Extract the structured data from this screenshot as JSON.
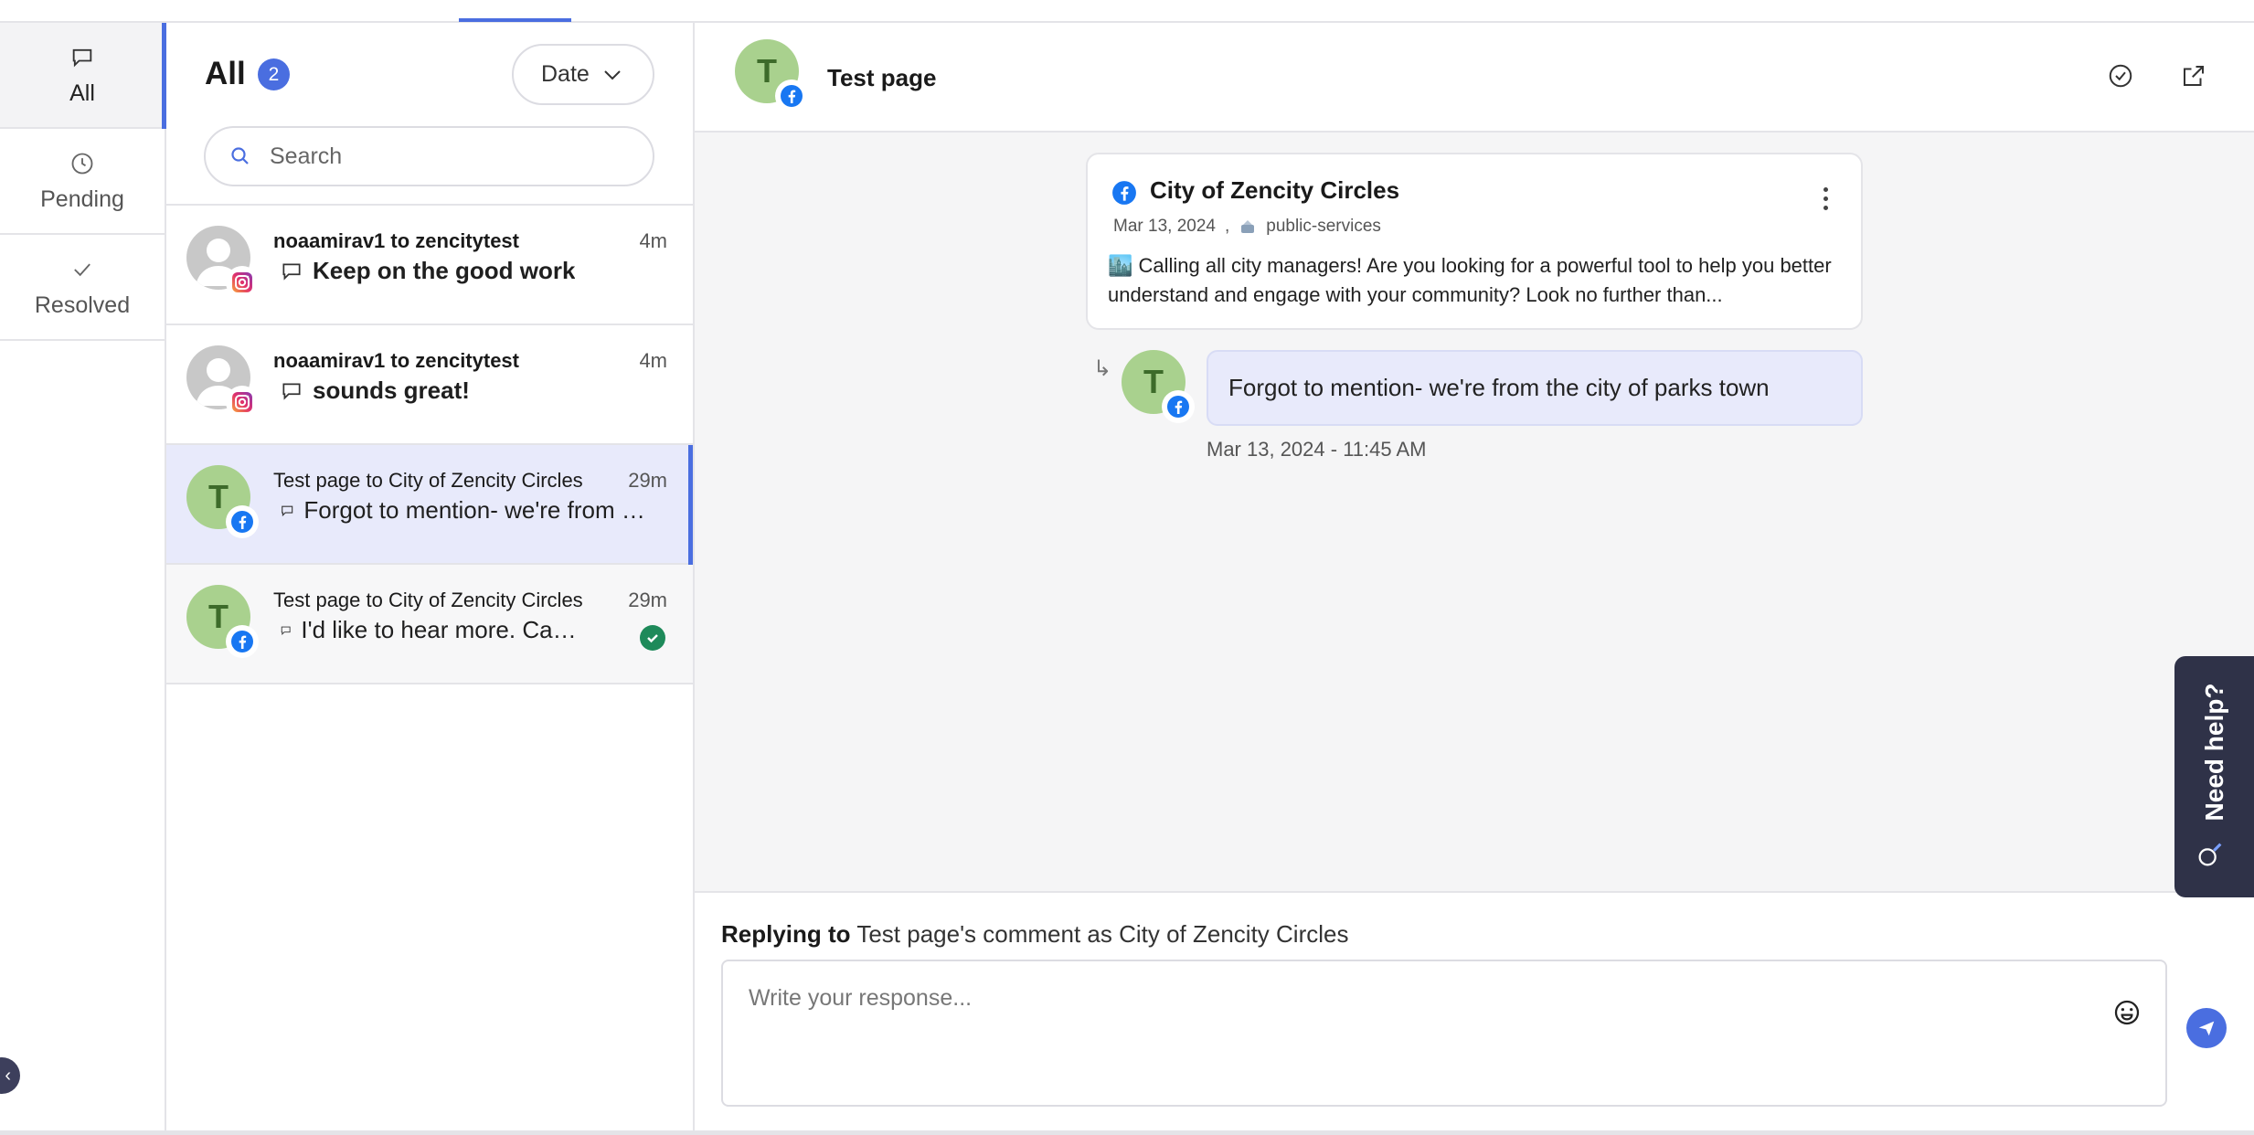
{
  "nav": {
    "items": [
      {
        "label": "All",
        "icon": "chat-bubble-icon",
        "active": true
      },
      {
        "label": "Pending",
        "icon": "clock-icon",
        "active": false
      },
      {
        "label": "Resolved",
        "icon": "checkmark-icon",
        "active": false
      }
    ]
  },
  "list": {
    "title": "All",
    "count": "2",
    "sort_label": "Date",
    "search_placeholder": "Search",
    "conversations": [
      {
        "from": "noaamirav1 to zencitytest",
        "time": "4m",
        "message": "Keep on the good work",
        "network": "instagram",
        "avatar": "user"
      },
      {
        "from": "noaamirav1 to zencitytest",
        "time": "4m",
        "message": "sounds great!",
        "network": "instagram",
        "avatar": "user"
      },
      {
        "from": "Test page to City of Zencity Circles",
        "time": "29m",
        "message": "Forgot to mention- we're from the city of parks town",
        "network": "facebook",
        "avatar": "T",
        "selected": true
      },
      {
        "from": "Test page to City of Zencity Circles",
        "time": "29m",
        "message": "I'd like to hear more. Can you tell me more about it?",
        "network": "facebook",
        "avatar": "T",
        "resolved": true
      }
    ]
  },
  "detail": {
    "title": "Test page",
    "avatar_letter": "T",
    "post": {
      "page_name": "City of Zencity Circles",
      "date": "Mar 13, 2024",
      "separator": ",",
      "topic": "public-services",
      "body": "🏙️ Calling all city managers! Are you looking for a powerful tool to help you better understand and engage with your community? Look no further than..."
    },
    "reply": {
      "avatar_letter": "T",
      "text": "Forgot to mention- we're from the city of parks town",
      "timestamp": "Mar 13, 2024 - 11:45 AM"
    },
    "composer": {
      "replying_prefix": "Replying to",
      "replying_rest": "Test page's comment as City of Zencity Circles",
      "placeholder": "Write your response..."
    }
  },
  "help": {
    "label": "Need help?"
  },
  "colors": {
    "accent": "#4a6ee0",
    "avatar_green": "#a9d18e",
    "selected_row": "#e8eafb",
    "resolved_green": "#1e8a5a",
    "help_tab": "#2f3248"
  }
}
